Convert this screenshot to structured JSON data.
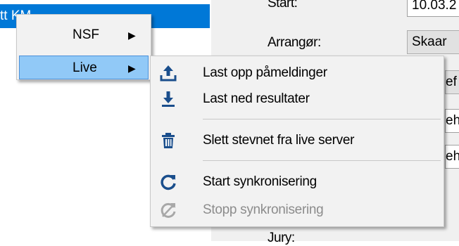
{
  "background": {
    "selected_row_text": "tt KM",
    "form": {
      "start_label": "Start:",
      "start_value": "10.03.2",
      "arranger_label": "Arrangør:",
      "arranger_value": "Skaar",
      "partial_1": "ef",
      "partial_2": "eh",
      "partial_3": "eh",
      "jury_label": "Jury:"
    }
  },
  "context_menu": {
    "items": [
      {
        "label": "NSF",
        "submenu_arrow": "▶"
      },
      {
        "label": "Live",
        "submenu_arrow": "▶",
        "highlighted": true
      }
    ]
  },
  "live_submenu": {
    "items": [
      {
        "label": "Last opp påmeldinger",
        "icon": "upload-icon"
      },
      {
        "label": "Last ned resultater",
        "icon": "download-icon"
      },
      {
        "label": "Slett stevnet fra live server",
        "icon": "trash-icon"
      },
      {
        "label": "Start synkronisering",
        "icon": "refresh-icon"
      },
      {
        "label": "Stopp synkronisering",
        "icon": "stop-sync-icon",
        "disabled": true
      }
    ]
  },
  "colors": {
    "selection_blue": "#0078d7",
    "highlight_bg": "#91c9f7",
    "highlight_border": "#4a90d9",
    "icon_blue": "#1a4e8c",
    "disabled_text": "#8c8c8c"
  }
}
